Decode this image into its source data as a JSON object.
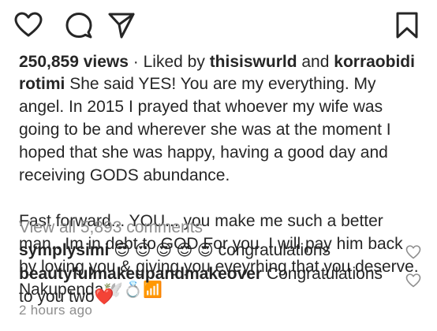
{
  "actions": {
    "like_icon": "heart-outline",
    "comment_icon": "speech-bubble",
    "share_icon": "paper-plane",
    "save_icon": "bookmark"
  },
  "stats": {
    "views": "250,859 views",
    "separator": " · ",
    "liked_by_prefix": "Liked by ",
    "liker1": "thisiswurld",
    "and": " and ",
    "liker2": "korraobidi"
  },
  "caption": {
    "username": "rotimi",
    "para1": "She said YES! You are my everything. My angel. In 2015 I prayed that whoever my wife was going to be and wherever she was at the moment I hoped that she was happy, having a good day and receiving GODS abundance.",
    "para2": "Fast forward... YOU... you make me such a better man.. Im in debt to GOD For you. I will pay him back by loving you & giving you eveyrhing that you deserve. Nakupenda",
    "para2_emojis": "🕊️💍📶"
  },
  "view_comments": "View all 5,893 comments",
  "comments": [
    {
      "username": "symplysimi",
      "emojis": "😍 😍 😍 😍 😍",
      "text": "congratulations"
    },
    {
      "username": "beautyfulmakeupandmakeover",
      "text": "Congratulations to you two",
      "emoji": "❤️"
    }
  ],
  "timestamp": "2 hours ago"
}
